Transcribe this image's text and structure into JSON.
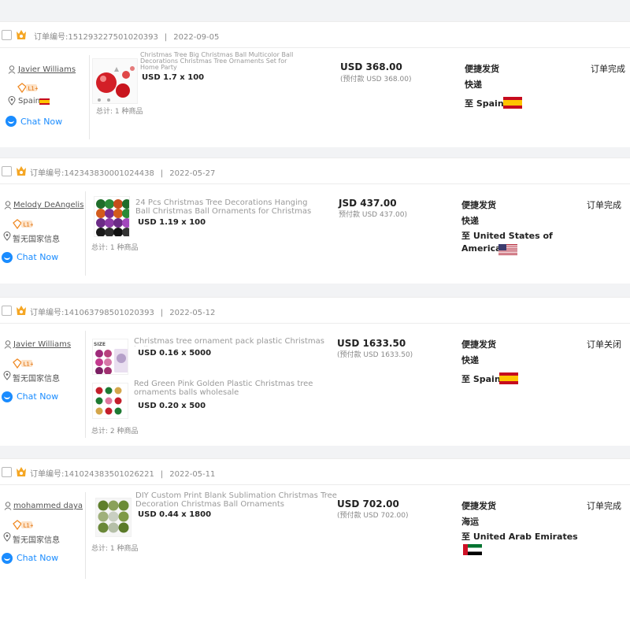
{
  "orders": [
    {
      "order_no": "订单编号:151293227501020393",
      "date": "2022-09-05",
      "buyer": {
        "name": "Javier Williams",
        "level": "L1+",
        "location": "Spain"
      },
      "chat": "Chat Now",
      "products": [
        {
          "name": "Christmas Tree Big Christmas Ball Multicolor Ball Decorations Christmas Tree Ornaments Set for Home Party",
          "qty": "USD 1.7 x 100"
        }
      ],
      "product_count": "总计: 1 种商品",
      "price": "USD 368.00",
      "prepaid": "(预付款 USD 368.00)",
      "ship_type": "便捷发货",
      "ship_method": "快递",
      "destination": "至 Spain",
      "destination_line2": "",
      "status": "订单完成"
    },
    {
      "order_no": "订单编号:142343830001024438",
      "date": "2022-05-27",
      "buyer": {
        "name": "Melody DeAngelis",
        "level": "L1+",
        "location": "暂无国家信息"
      },
      "chat": "Chat Now",
      "products": [
        {
          "name": "24 Pcs Christmas Tree Decorations Hanging Ball Christmas Ball Ornaments for Christmas Tree",
          "qty": "USD 1.19 x 100"
        }
      ],
      "product_count": "总计: 1 种商品",
      "price": "JSD 437.00",
      "prepaid": "预付款 USD 437.00)",
      "ship_type": "便捷发货",
      "ship_method": "快递",
      "destination": "至 United States of",
      "destination_line2": "America",
      "status": "订单完成"
    },
    {
      "order_no": "订单编号:141063798501020393",
      "date": "2022-05-12",
      "buyer": {
        "name": "Javier Williams",
        "level": "L1+",
        "location": "暂无国家信息"
      },
      "chat": "Chat Now",
      "products": [
        {
          "name": "Christmas tree ornament pack plastic Christmas ball",
          "qty": "USD 0.16 x 5000",
          "thumb_label": "SIZE"
        },
        {
          "name": "Red Green Pink Golden Plastic Christmas tree ornaments balls wholesale",
          "qty": "USD 0.20 x 500"
        }
      ],
      "product_count": "总计: 2 种商品",
      "price": "USD 1633.50",
      "prepaid": "(预付款 USD 1633.50)",
      "ship_type": "便捷发货",
      "ship_method": "快递",
      "destination": "至 Spain",
      "destination_line2": "",
      "status": "订单关闭"
    },
    {
      "order_no": "订单编号:141024383501026221",
      "date": "2022-05-11",
      "buyer": {
        "name": "mohammed daya",
        "level": "L1+",
        "location": "暂无国家信息"
      },
      "chat": "Chat Now",
      "products": [
        {
          "name": "DIY Custom Print Blank Sublimation Christmas Tree Decoration Christmas Ball Ornaments",
          "qty": "USD 0.44 x 1800"
        }
      ],
      "product_count": "总计: 1 种商品",
      "price": "USD 702.00",
      "prepaid": "(预付款 USD 702.00)",
      "ship_type": "便捷发货",
      "ship_method": "海运",
      "destination": "至 United Arab Emirates",
      "destination_line2": "",
      "status": "订单完成"
    }
  ],
  "icons": [
    "checkbox-icon",
    "crown-badge-icon",
    "person-icon",
    "level-badge-icon",
    "location-pin-icon",
    "chat-bubble-icon",
    "flag-spain-icon",
    "flag-usa-icon",
    "flag-uae-icon"
  ],
  "colors": {
    "chat": "#1a8cff",
    "badge": "#f5a623",
    "level": "#f08a24",
    "separator": "#f2f3f5"
  }
}
